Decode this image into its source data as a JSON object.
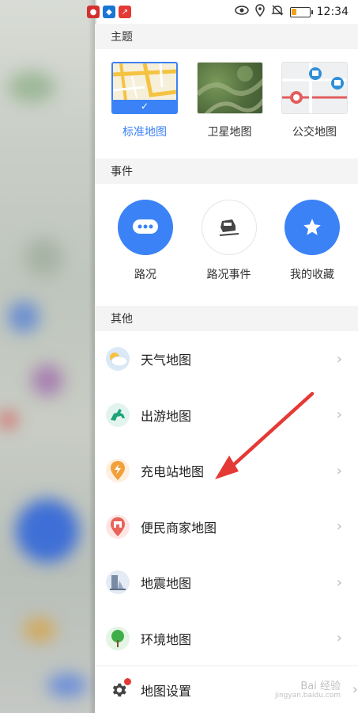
{
  "status_bar": {
    "time": "12:34",
    "battery_level": 0.25
  },
  "theme_section": {
    "title": "主题",
    "items": [
      {
        "label": "标准地图",
        "selected": true
      },
      {
        "label": "卫星地图",
        "selected": false
      },
      {
        "label": "公交地图",
        "selected": false
      }
    ],
    "check_mark": "✓"
  },
  "event_section": {
    "title": "事件",
    "items": [
      {
        "label": "路况",
        "icon": "chat-bubble-icon"
      },
      {
        "label": "路况事件",
        "icon": "car-accident-icon"
      },
      {
        "label": "我的收藏",
        "icon": "star-icon"
      }
    ]
  },
  "other_section": {
    "title": "其他",
    "items": [
      {
        "label": "天气地图",
        "icon": "weather-icon"
      },
      {
        "label": "出游地图",
        "icon": "horse-icon"
      },
      {
        "label": "充电站地图",
        "icon": "charging-icon"
      },
      {
        "label": "便民商家地图",
        "icon": "shop-icon"
      },
      {
        "label": "地震地图",
        "icon": "earthquake-icon"
      },
      {
        "label": "环境地图",
        "icon": "tree-icon"
      }
    ],
    "chevron": "›"
  },
  "settings": {
    "label": "地图设置"
  },
  "watermark": {
    "text": "Bai 经验",
    "sub": "jingyan.baidu.com"
  },
  "colors": {
    "accent": "#3b82f6",
    "arrow": "#e53935"
  }
}
